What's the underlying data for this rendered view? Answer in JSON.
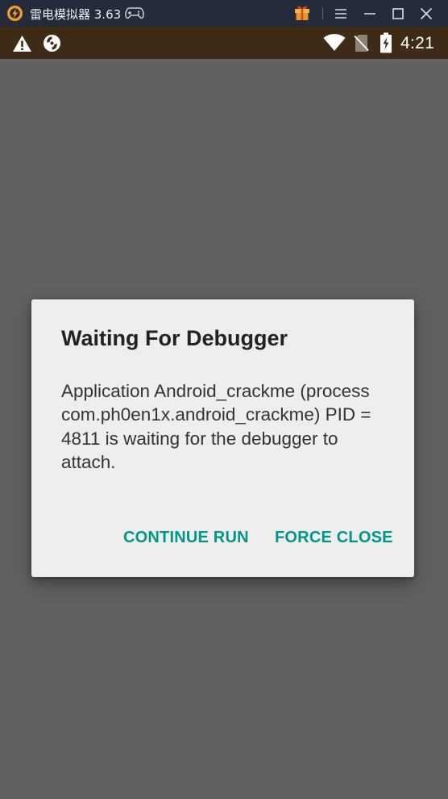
{
  "emulator": {
    "title": "雷电模拟器 3.63",
    "icons": [
      "app-logo-icon",
      "gamepad-icon",
      "gift-icon",
      "menu-icon",
      "minimize-icon",
      "maximize-icon",
      "close-icon"
    ],
    "colors": {
      "bar": "#242b3a",
      "logo": "#f39a2b",
      "gift": "#f0b43c"
    }
  },
  "status_bar": {
    "icons": [
      "warning-icon",
      "sync-icon",
      "wifi-icon",
      "no-sim-icon",
      "battery-charging-icon"
    ],
    "time": "4:21",
    "color": "#3e2b16"
  },
  "dialog": {
    "title": "Waiting For Debugger",
    "message": "Application Android_crackme (process com.ph0en1x.android_crackme) PID = 4811 is waiting for the debugger to attach.",
    "buttons": {
      "continue": "CONTINUE RUN",
      "force_close": "FORCE CLOSE"
    },
    "accent_color": "#009688"
  },
  "scrim_color": "#616161"
}
